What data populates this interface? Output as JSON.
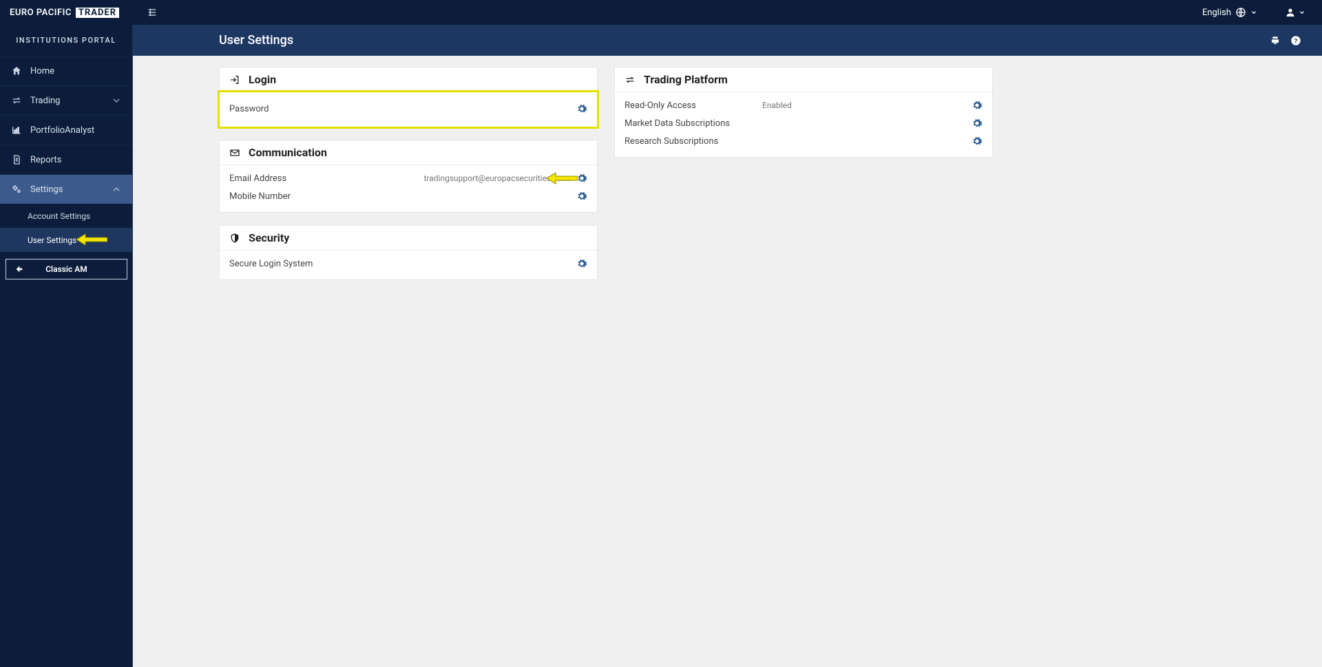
{
  "brand": {
    "left": "EURO PACIFIC",
    "box": "TRADER"
  },
  "topbar": {
    "language": "English"
  },
  "sidebar": {
    "portal_label": "INSTITUTIONS PORTAL",
    "items": [
      {
        "label": "Home"
      },
      {
        "label": "Trading"
      },
      {
        "label": "PortfolioAnalyst"
      },
      {
        "label": "Reports"
      },
      {
        "label": "Settings"
      }
    ],
    "sub": {
      "account": "Account Settings",
      "user": "User Settings"
    },
    "classic_btn": "Classic AM"
  },
  "page": {
    "title": "User Settings"
  },
  "panels": {
    "login": {
      "title": "Login",
      "password_label": "Password"
    },
    "comm": {
      "title": "Communication",
      "email_label": "Email Address",
      "email_value": "tradingsupport@europacsecurities.com",
      "mobile_label": "Mobile Number"
    },
    "security": {
      "title": "Security",
      "sls_label": "Secure Login System"
    },
    "trading": {
      "title": "Trading Platform",
      "readonly_label": "Read-Only Access",
      "readonly_value": "Enabled",
      "mds_label": "Market Data Subscriptions",
      "rs_label": "Research Subscriptions"
    }
  }
}
